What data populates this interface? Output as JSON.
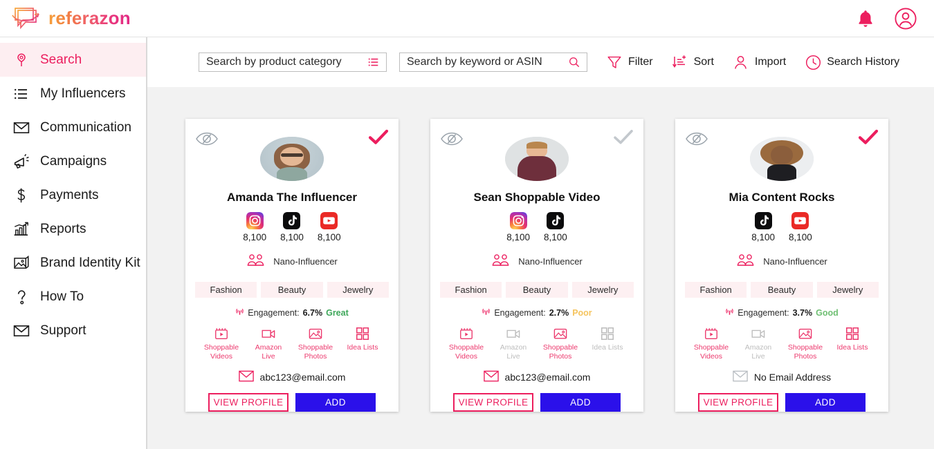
{
  "brand": {
    "name": "referazon",
    "logo_icon": "speech-bubble-arrow-logo"
  },
  "header": {
    "notification_icon": "bell-icon",
    "account_icon": "user-circle-icon"
  },
  "sidebar": {
    "items": [
      {
        "label": "Search",
        "icon": "location-pin-icon",
        "active": true
      },
      {
        "label": "My Influencers",
        "icon": "list-icon",
        "active": false
      },
      {
        "label": "Communication",
        "icon": "envelope-icon",
        "active": false
      },
      {
        "label": "Campaigns",
        "icon": "megaphone-icon",
        "active": false
      },
      {
        "label": "Payments",
        "icon": "dollar-icon",
        "active": false
      },
      {
        "label": "Reports",
        "icon": "bar-chart-icon",
        "active": false
      },
      {
        "label": "Brand Identity Kit",
        "icon": "image-icon",
        "active": false
      },
      {
        "label": "How To",
        "icon": "question-mark-icon",
        "active": false
      },
      {
        "label": "Support",
        "icon": "envelope-icon",
        "active": false
      }
    ]
  },
  "toolbar": {
    "category_search": {
      "placeholder": "Search by product category",
      "value": "",
      "icon": "list-lines-icon"
    },
    "keyword_search": {
      "placeholder": "Search by keyword or ASIN",
      "value": "",
      "icon": "search-icon"
    },
    "buttons": [
      {
        "label": "Filter",
        "icon": "funnel-icon"
      },
      {
        "label": "Sort",
        "icon": "sort-plus-icon"
      },
      {
        "label": "Import",
        "icon": "person-icon"
      },
      {
        "label": "Search History",
        "icon": "clock-icon"
      }
    ]
  },
  "colors": {
    "accent_pink": "#ec1e5e",
    "accent_pink_light": "#ec3a6e",
    "add_button_blue": "#2b10ea",
    "tag_background": "#fdf0f2",
    "rate_great": "#3ea75a",
    "rate_good": "#6fbf73",
    "rate_poor": "#f5c45e",
    "muted_gray": "#bdbdbd"
  },
  "cards": [
    {
      "name": "Amanda The Influencer",
      "hide_icon": "eye-slash-icon",
      "selected": true,
      "check_icon": "checkmark-icon",
      "avatar": "woman-glasses-avatar",
      "socials": [
        {
          "platform": "instagram",
          "count": "8,100"
        },
        {
          "platform": "tiktok",
          "count": "8,100"
        },
        {
          "platform": "youtube",
          "count": "8,100"
        }
      ],
      "tier_icon": "group-people-icon",
      "tier": "Nano-Influencer",
      "tags": [
        "Fashion",
        "Beauty",
        "Jewelry"
      ],
      "engagement": {
        "icon": "signal-icon",
        "label": "Engagement:",
        "value": "6.7%",
        "rating": "Great",
        "rating_class": "great"
      },
      "features": [
        {
          "label": "Shoppable Videos",
          "icon": "video-play-icon",
          "active": true
        },
        {
          "label": "Amazon Live",
          "icon": "video-camera-icon",
          "active": true
        },
        {
          "label": "Shoppable Photos",
          "icon": "photo-icon",
          "active": true
        },
        {
          "label": "Idea Lists",
          "icon": "grid-icon",
          "active": true
        }
      ],
      "email": {
        "icon": "envelope-icon",
        "text": "abc123@email.com",
        "has_email": true
      },
      "view_button": "VIEW PROFILE",
      "add_button": "ADD"
    },
    {
      "name": "Sean Shoppable Video",
      "hide_icon": "eye-slash-icon",
      "selected": false,
      "check_icon": "checkmark-icon",
      "avatar": "man-maroon-shirt-avatar",
      "socials": [
        {
          "platform": "instagram",
          "count": "8,100"
        },
        {
          "platform": "tiktok",
          "count": "8,100"
        }
      ],
      "tier_icon": "group-people-icon",
      "tier": "Nano-Influencer",
      "tags": [
        "Fashion",
        "Beauty",
        "Jewelry"
      ],
      "engagement": {
        "icon": "signal-icon",
        "label": "Engagement:",
        "value": "2.7%",
        "rating": "Poor",
        "rating_class": "poor"
      },
      "features": [
        {
          "label": "Shoppable Videos",
          "icon": "video-play-icon",
          "active": true
        },
        {
          "label": "Amazon Live",
          "icon": "video-camera-icon",
          "active": false
        },
        {
          "label": "Shoppable Photos",
          "icon": "photo-icon",
          "active": true
        },
        {
          "label": "Idea Lists",
          "icon": "grid-icon",
          "active": false
        }
      ],
      "email": {
        "icon": "envelope-icon",
        "text": "abc123@email.com",
        "has_email": true
      },
      "view_button": "VIEW PROFILE",
      "add_button": "ADD"
    },
    {
      "name": "Mia Content Rocks",
      "hide_icon": "eye-slash-icon",
      "selected": true,
      "check_icon": "checkmark-icon",
      "avatar": "woman-curly-hair-avatar",
      "socials": [
        {
          "platform": "tiktok",
          "count": "8,100"
        },
        {
          "platform": "youtube",
          "count": "8,100"
        }
      ],
      "tier_icon": "group-people-icon",
      "tier": "Nano-Influencer",
      "tags": [
        "Fashion",
        "Beauty",
        "Jewelry"
      ],
      "engagement": {
        "icon": "signal-icon",
        "label": "Engagement:",
        "value": "3.7%",
        "rating": "Good",
        "rating_class": "good"
      },
      "features": [
        {
          "label": "Shoppable Videos",
          "icon": "video-play-icon",
          "active": true
        },
        {
          "label": "Amazon Live",
          "icon": "video-camera-icon",
          "active": false
        },
        {
          "label": "Shoppable Photos",
          "icon": "photo-icon",
          "active": true
        },
        {
          "label": "Idea Lists",
          "icon": "grid-icon",
          "active": true
        }
      ],
      "email": {
        "icon": "envelope-icon",
        "text": "No Email Address",
        "has_email": false
      },
      "view_button": "VIEW PROFILE",
      "add_button": "ADD"
    }
  ]
}
